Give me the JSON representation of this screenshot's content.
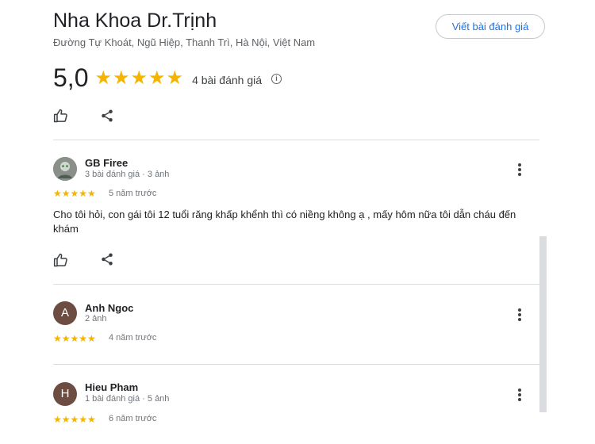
{
  "header": {
    "title": "Nha Khoa Dr.Trịnh",
    "address": "Đường Tự Khoát, Ngũ Hiệp, Thanh Trì, Hà Nội, Việt Nam",
    "write_review_label": "Viết bài đánh giá"
  },
  "rating": {
    "value": "5,0",
    "stars": "★★★★★",
    "count_label": "4 bài đánh giá",
    "info_glyph": "i",
    "star_color": "#f4b400"
  },
  "reviews": [
    {
      "name": "GB Firee",
      "meta": "3 bài đánh giá · 3 ảnh",
      "stars": "★★★★★",
      "time": "5 năm trước",
      "text": "Cho tôi hỏi, con gái tôi 12 tuổi răng khấp khểnh thì có niềng không ạ , mấy hôm nữa tôi dẫn cháu đến khám",
      "avatar_type": "photo"
    },
    {
      "name": "Anh Ngoc",
      "meta": "2 ảnh",
      "stars": "★★★★★",
      "time": "4 năm trước",
      "avatar_letter": "A",
      "avatar_color": "#6d4c41"
    },
    {
      "name": "Hieu Pham",
      "meta": "1 bài đánh giá · 5 ảnh",
      "stars": "★★★★★",
      "time": "6 năm trước",
      "avatar_letter": "H",
      "avatar_color": "#6d4c41"
    }
  ],
  "icons": {
    "like": "thumbs-up-icon",
    "share": "share-icon",
    "more": "more-vertical-icon",
    "info": "info-icon"
  },
  "accent_color": "#1a73e8"
}
